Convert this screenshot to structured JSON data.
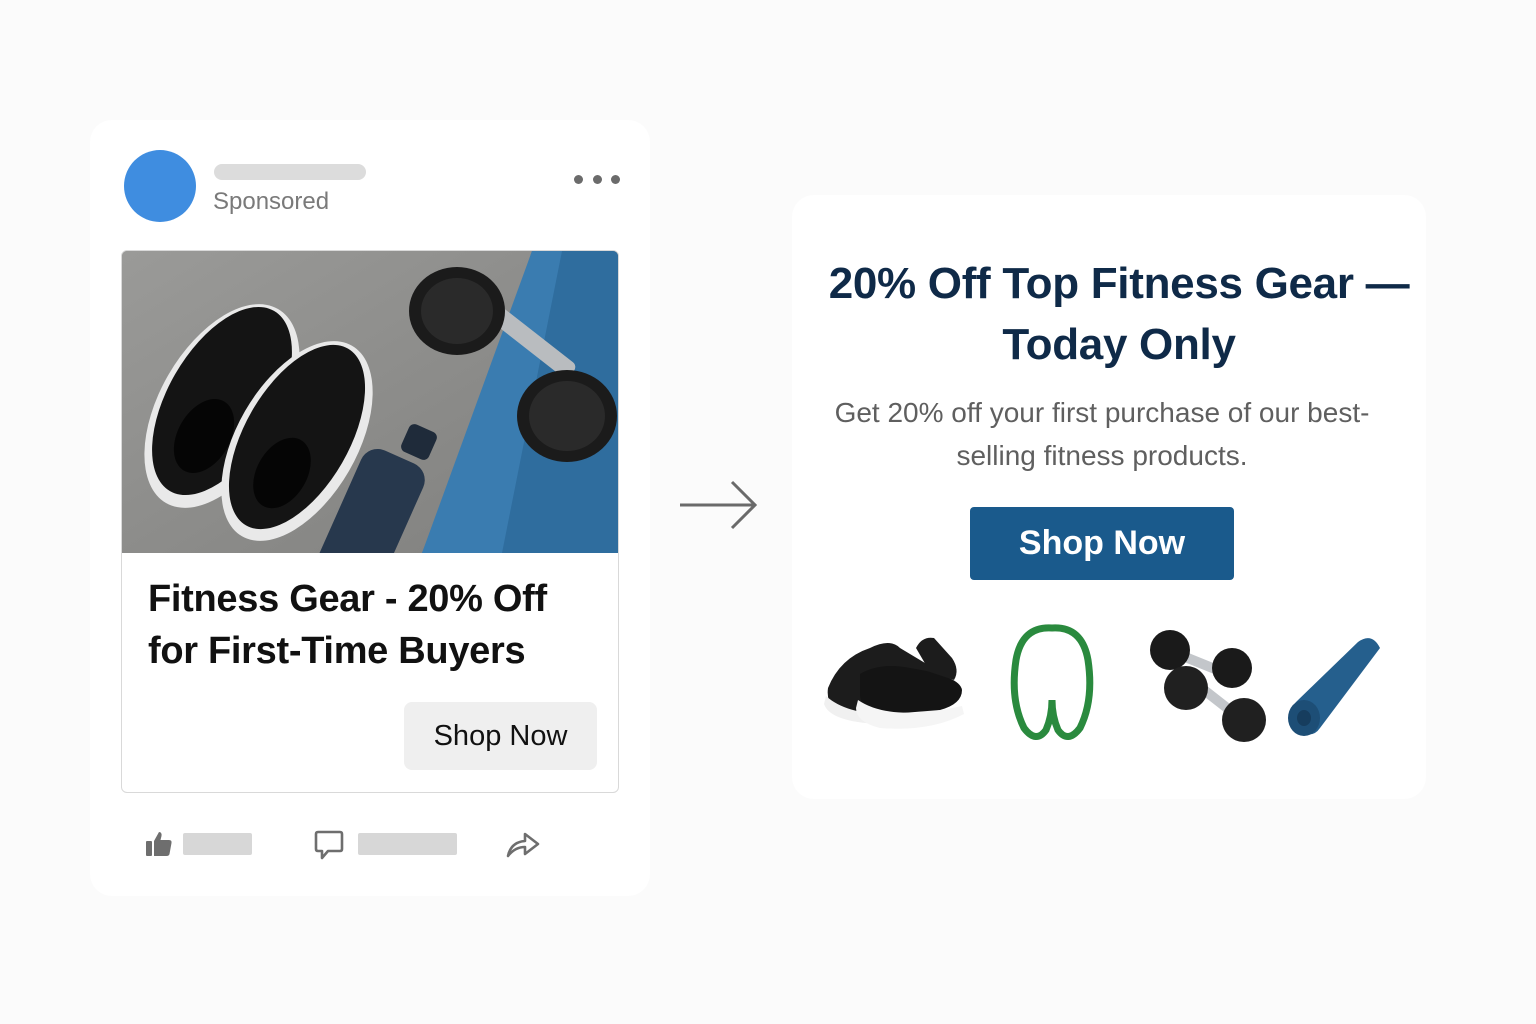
{
  "post": {
    "sponsored_label": "Sponsored",
    "ad_headline": "Fitness Gear - 20% Off for First-Time Buyers",
    "cta_label": "Shop Now",
    "avatar_color": "#3f8de0",
    "icons": [
      "more-options-icon",
      "like-icon",
      "comment-icon",
      "share-icon"
    ]
  },
  "landing": {
    "headline": "20% Off Top Fitness Gear — Today Only",
    "subtext": "Get 20% off your first purchase of our best-selling fitness products.",
    "cta_label": "Shop Now",
    "cta_color": "#1a5a8c",
    "headline_color": "#0f2a48",
    "products": [
      "sneakers",
      "resistance-band",
      "dumbbells",
      "yoga-mat"
    ]
  }
}
